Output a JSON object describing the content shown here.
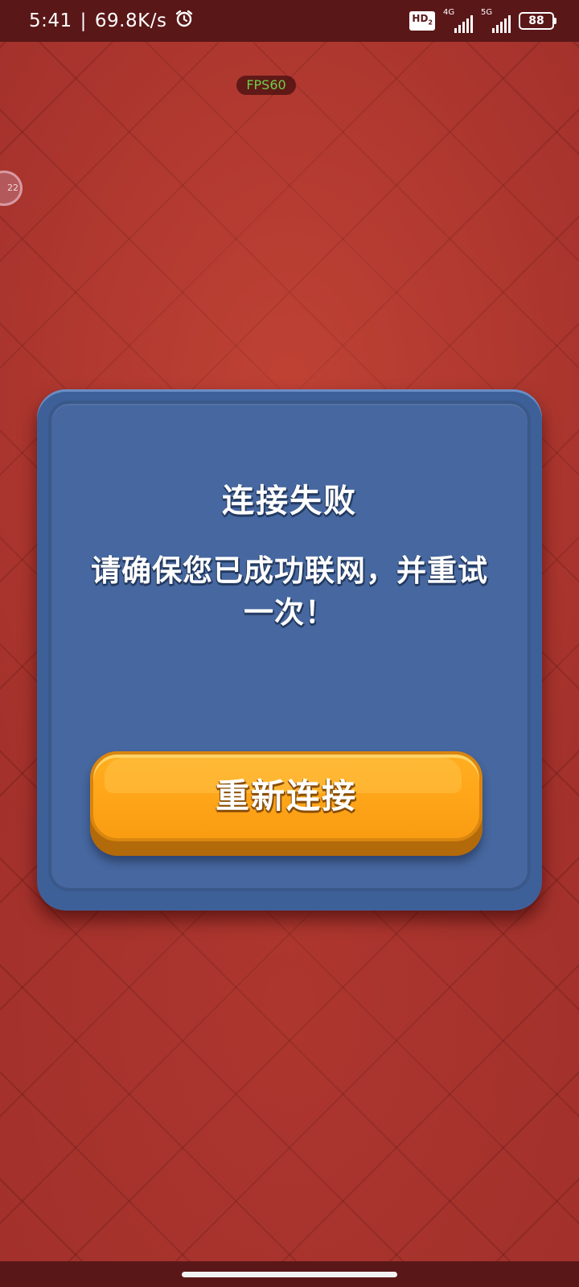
{
  "status_bar": {
    "time": "5:41",
    "separator": "|",
    "network_speed": "69.8K/s",
    "alarm_icon": "alarm-clock-icon",
    "hd_badge": "HD",
    "hd_sub": "2",
    "network_1": "4G",
    "network_2": "5G",
    "signal_icon": "cellular-signal-icon",
    "battery_level": "88",
    "battery_icon": "battery-icon"
  },
  "overlay": {
    "fps_label": "FPS60",
    "side_bubble_text": "22"
  },
  "dialog": {
    "title": "连接失败",
    "message": "请确保您已成功联网，并重试一次！",
    "button_label": "重新连接",
    "colors": {
      "panel": "#3e6099",
      "panel_inner": "#46679f",
      "button": "#ffa61a",
      "background": "#a2302b"
    }
  }
}
